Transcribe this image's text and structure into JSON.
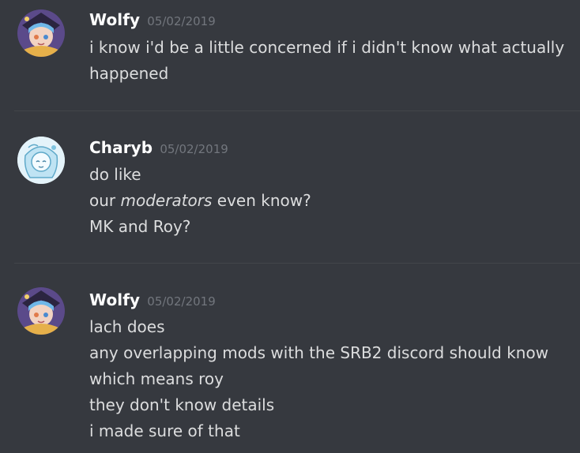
{
  "colors": {
    "background": "#36393f",
    "username": "#ffffff",
    "timestamp": "#72767d",
    "message_text": "#dcddde",
    "divider": "#42454a"
  },
  "messages": [
    {
      "author": "Wolfy",
      "timestamp": "05/02/2019",
      "avatar_icon": "wolfy-avatar-icon",
      "lines": [
        "i know i'd be a little concerned if i didn't know what actually",
        "happened"
      ]
    },
    {
      "author": "Charyb",
      "timestamp": "05/02/2019",
      "avatar_icon": "charyb-avatar-icon",
      "lines": [
        "do like",
        "our ",
        "moderators",
        " even know?",
        "MK and Roy?"
      ]
    },
    {
      "author": "Wolfy",
      "timestamp": "05/02/2019",
      "avatar_icon": "wolfy-avatar-icon",
      "lines": [
        "lach does",
        "any overlapping mods with the SRB2 discord should know",
        "which means roy",
        "they don't know details",
        "i made sure of that"
      ]
    }
  ]
}
